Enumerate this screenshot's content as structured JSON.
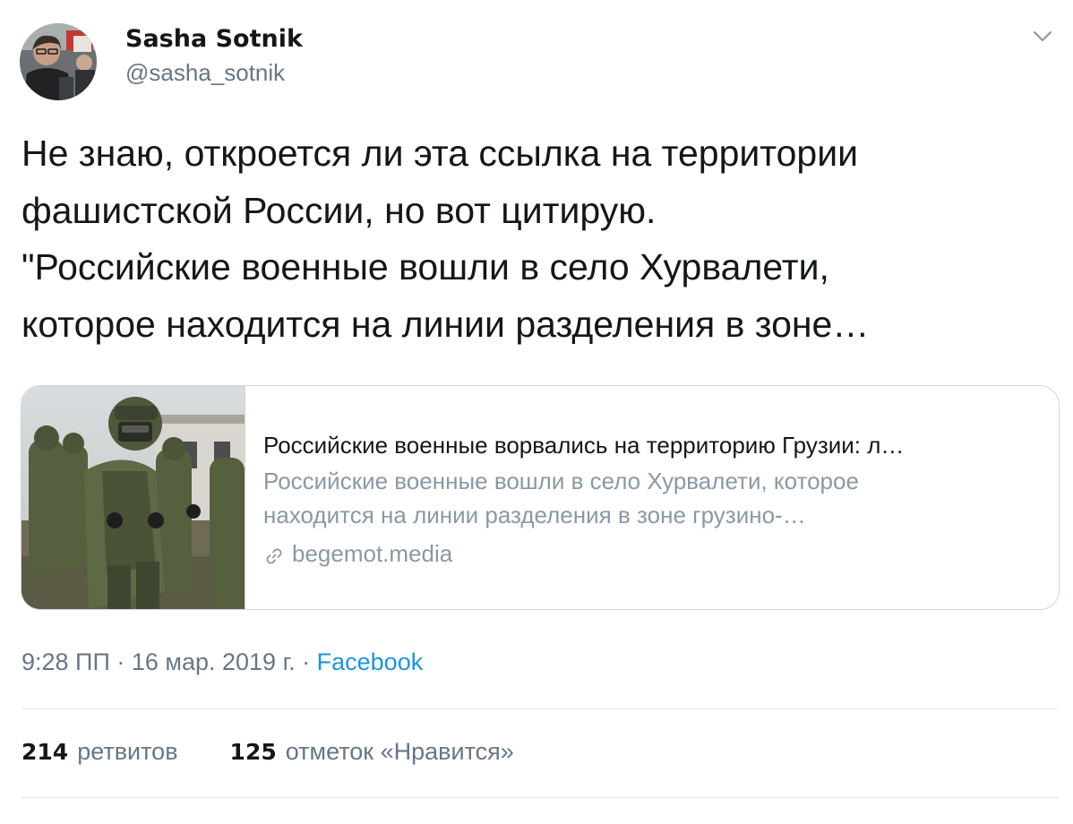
{
  "author": {
    "name": "Sasha Sotnik",
    "handle": "@sasha_sotnik"
  },
  "icons": {
    "avatar": "user-photo-avatar",
    "more": "chevron-down-icon",
    "link": "link-icon",
    "card_image": "soldiers-photo"
  },
  "tweet": {
    "lines": [
      "Не знаю, откроется ли эта ссылка на территории",
      "фашистской России, но вот цитирую.",
      "\"Российские военные вошли в село Хурвалети,",
      "которое находится на линии разделения в зоне…"
    ]
  },
  "card": {
    "title": "Российские военные ворвались на территорию Грузии: л…",
    "description_lines": [
      "Российские военные вошли в село Хурвалети, которое",
      "находится на линии разделения в зоне грузино-…"
    ],
    "domain": "begemot.media"
  },
  "meta": {
    "time": "9:28 ПП",
    "sep1": " · ",
    "date": "16 мар. 2019 г.",
    "sep2": " · ",
    "source": "Facebook"
  },
  "stats": {
    "retweets_count": "214",
    "retweets_label": "ретвитов",
    "likes_count": "125",
    "likes_label": "отметок «Нравится»"
  },
  "colors": {
    "text": "#14171a",
    "secondary": "#657786",
    "card_secondary": "#8899a6",
    "link": "#1b95e0",
    "border": "#ccd6dd"
  }
}
